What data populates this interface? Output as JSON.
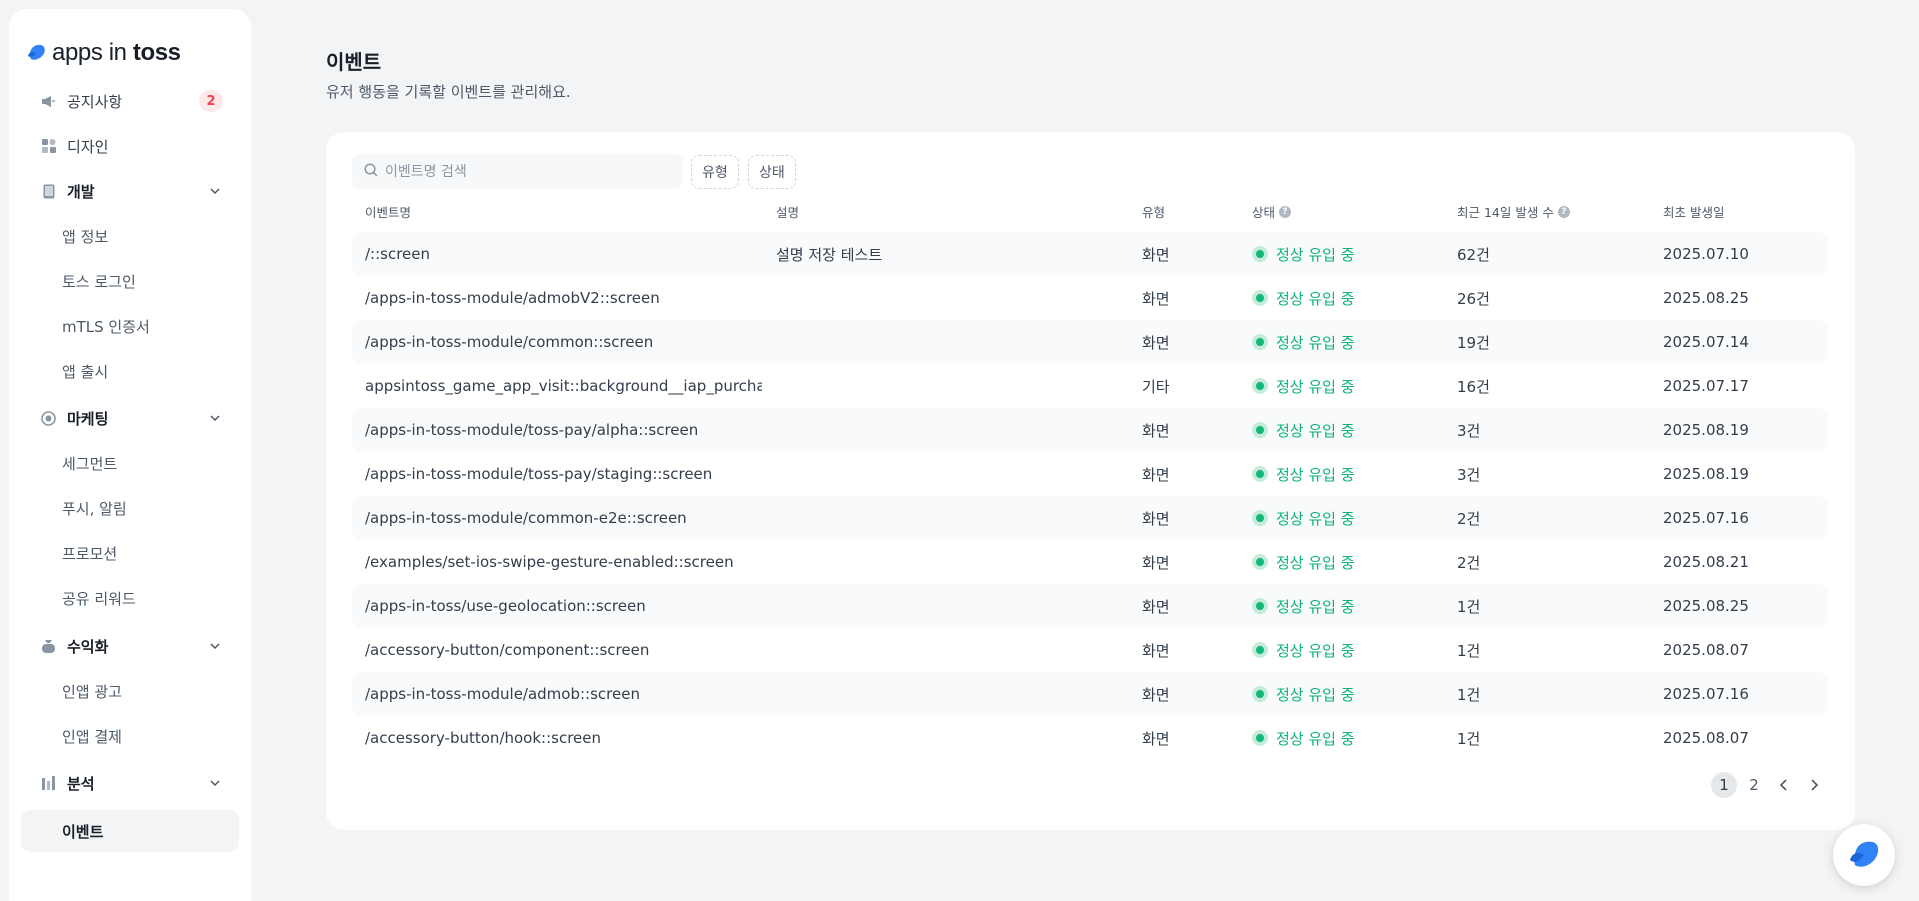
{
  "brand": {
    "name_light": "apps in ",
    "name_bold": "toss",
    "accent": "#3182f6"
  },
  "sidebar": {
    "items": [
      {
        "label": "공지사항",
        "icon": "megaphone-icon",
        "badge": "2"
      },
      {
        "label": "디자인",
        "icon": "shapes-icon"
      },
      {
        "label": "개발",
        "icon": "device-icon"
      },
      {
        "label": "앱 정보"
      },
      {
        "label": "토스 로그인"
      },
      {
        "label": "mTLS 인증서"
      },
      {
        "label": "앱 출시"
      },
      {
        "label": "마케팅",
        "icon": "target-icon"
      },
      {
        "label": "세그먼트"
      },
      {
        "label": "푸시, 알림"
      },
      {
        "label": "프로모션"
      },
      {
        "label": "공유 리워드"
      },
      {
        "label": "수익화",
        "icon": "money-bag-icon"
      },
      {
        "label": "인앱 광고"
      },
      {
        "label": "인앱 결제"
      },
      {
        "label": "분석",
        "icon": "bar-chart-icon"
      },
      {
        "label": "이벤트"
      }
    ]
  },
  "page": {
    "title": "이벤트",
    "subtitle": "유저 행동을 기록할 이벤트를 관리해요."
  },
  "filters": {
    "search_placeholder": "이벤트명 검색",
    "type_chip": "유형",
    "status_chip": "상태"
  },
  "table": {
    "headers": {
      "name": "이벤트명",
      "desc": "설명",
      "type": "유형",
      "status": "상태",
      "count": "최근 14일 발생 수",
      "date": "최초 발생일"
    },
    "status_color": "#0bb27a",
    "rows": [
      {
        "name": "/::screen",
        "desc": "설명 저장 테스트",
        "type": "화면",
        "status": "정상 유입 중",
        "count": "62건",
        "date": "2025.07.10"
      },
      {
        "name": "/apps-in-toss-module/admobV2::screen",
        "desc": "",
        "type": "화면",
        "status": "정상 유입 중",
        "count": "26건",
        "date": "2025.08.25"
      },
      {
        "name": "/apps-in-toss-module/common::screen",
        "desc": "",
        "type": "화면",
        "status": "정상 유입 중",
        "count": "19건",
        "date": "2025.07.14"
      },
      {
        "name": "appsintoss_game_app_visit::background__iap_purchase_",
        "desc": "",
        "type": "기타",
        "status": "정상 유입 중",
        "count": "16건",
        "date": "2025.07.17"
      },
      {
        "name": "/apps-in-toss-module/toss-pay/alpha::screen",
        "desc": "",
        "type": "화면",
        "status": "정상 유입 중",
        "count": "3건",
        "date": "2025.08.19"
      },
      {
        "name": "/apps-in-toss-module/toss-pay/staging::screen",
        "desc": "",
        "type": "화면",
        "status": "정상 유입 중",
        "count": "3건",
        "date": "2025.08.19"
      },
      {
        "name": "/apps-in-toss-module/common-e2e::screen",
        "desc": "",
        "type": "화면",
        "status": "정상 유입 중",
        "count": "2건",
        "date": "2025.07.16"
      },
      {
        "name": "/examples/set-ios-swipe-gesture-enabled::screen",
        "desc": "",
        "type": "화면",
        "status": "정상 유입 중",
        "count": "2건",
        "date": "2025.08.21"
      },
      {
        "name": "/apps-in-toss/use-geolocation::screen",
        "desc": "",
        "type": "화면",
        "status": "정상 유입 중",
        "count": "1건",
        "date": "2025.08.25"
      },
      {
        "name": "/accessory-button/component::screen",
        "desc": "",
        "type": "화면",
        "status": "정상 유입 중",
        "count": "1건",
        "date": "2025.08.07"
      },
      {
        "name": "/apps-in-toss-module/admob::screen",
        "desc": "",
        "type": "화면",
        "status": "정상 유입 중",
        "count": "1건",
        "date": "2025.07.16"
      },
      {
        "name": "/accessory-button/hook::screen",
        "desc": "",
        "type": "화면",
        "status": "정상 유입 중",
        "count": "1건",
        "date": "2025.08.07"
      }
    ]
  },
  "pagination": {
    "pages": [
      "1",
      "2"
    ],
    "current": "1"
  }
}
